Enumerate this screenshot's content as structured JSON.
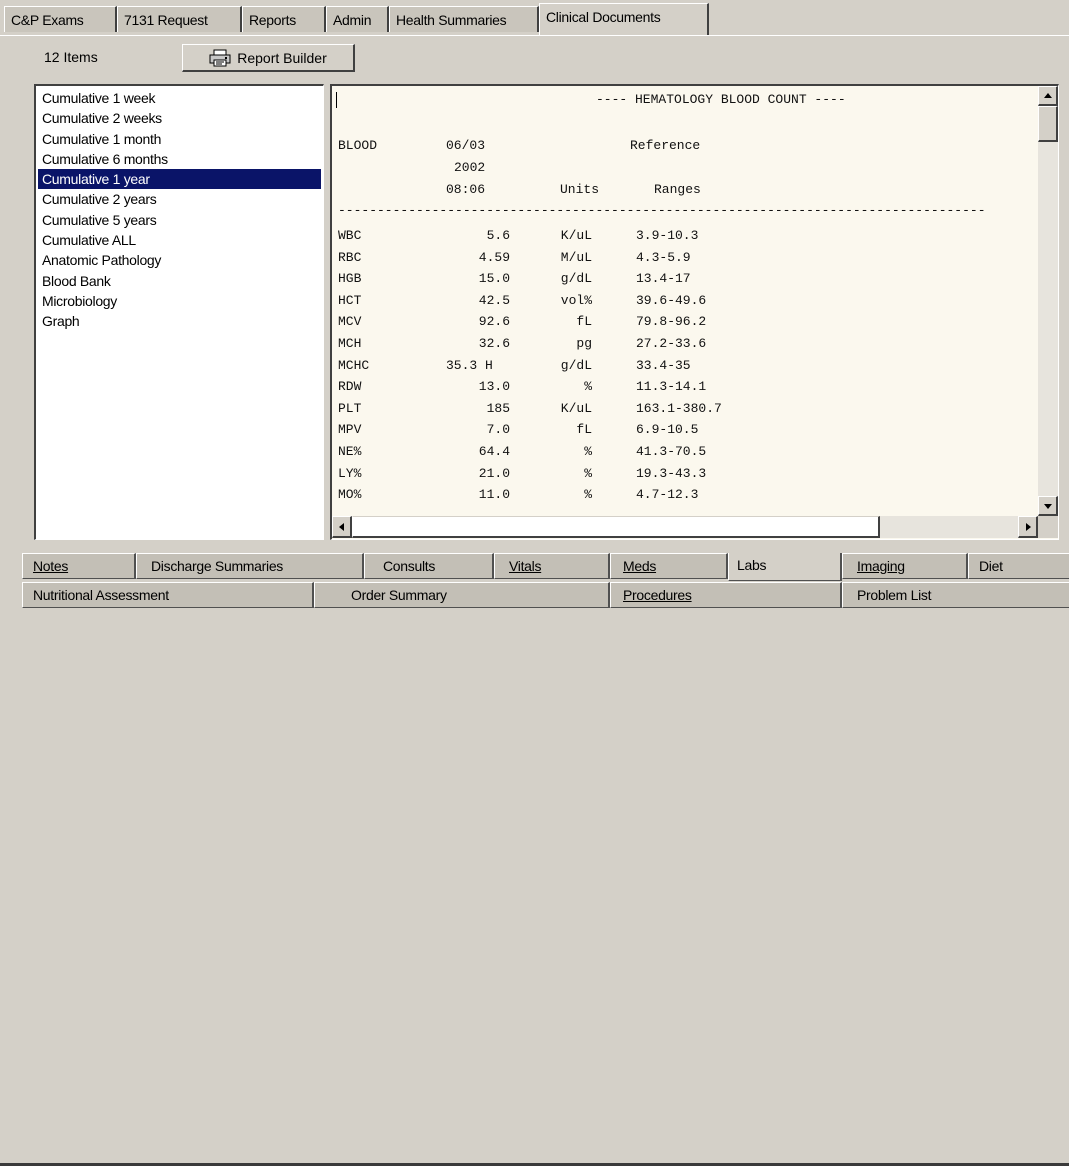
{
  "top_tabs": [
    {
      "label": "C&P Exams"
    },
    {
      "label": "7131 Request"
    },
    {
      "label": "Reports"
    },
    {
      "label": "Admin"
    },
    {
      "label": "Health Summaries"
    },
    {
      "label": "Clinical Documents",
      "active": true
    }
  ],
  "panel": {
    "items_count": "12 Items",
    "report_builder_label": "Report Builder"
  },
  "report_list": [
    "Cumulative 1 week",
    "Cumulative 2 weeks",
    "Cumulative 1 month",
    "Cumulative 6 months",
    "Cumulative 1 year",
    "Cumulative 2 years",
    "Cumulative 5 years",
    "Cumulative ALL",
    "Anatomic Pathology",
    "Blood Bank",
    "Microbiology",
    "Graph"
  ],
  "selected_report": "Cumulative 1 year",
  "report": {
    "title": "---- HEMATOLOGY BLOOD COUNT ----",
    "header": {
      "col1": "BLOOD",
      "date": "06/03",
      "year": "2002",
      "time": "08:06",
      "units": "Units",
      "reference": "Reference",
      "ranges": "Ranges"
    },
    "divider": "-----------------------------------------------------------------------------------",
    "rows": [
      {
        "test": "WBC",
        "value": "5.6",
        "units": "K/uL",
        "range": "3.9-10.3"
      },
      {
        "test": "RBC",
        "value": "4.59",
        "units": "M/uL",
        "range": "4.3-5.9"
      },
      {
        "test": "HGB",
        "value": "15.0",
        "units": "g/dL",
        "range": "13.4-17"
      },
      {
        "test": "HCT",
        "value": "42.5",
        "units": "vol%",
        "range": "39.6-49.6"
      },
      {
        "test": "MCV",
        "value": "92.6",
        "units": "fL",
        "range": "79.8-96.2"
      },
      {
        "test": "MCH",
        "value": "32.6",
        "units": "pg",
        "range": "27.2-33.6"
      },
      {
        "test": "MCHC",
        "value": "35.3 H",
        "units": "g/dL",
        "range": "33.4-35"
      },
      {
        "test": "RDW",
        "value": "13.0",
        "units": "%",
        "range": "11.3-14.1"
      },
      {
        "test": "PLT",
        "value": "185",
        "units": "K/uL",
        "range": "163.1-380.7"
      },
      {
        "test": "MPV",
        "value": "7.0",
        "units": "fL",
        "range": "6.9-10.5"
      },
      {
        "test": "NE%",
        "value": "64.4",
        "units": "%",
        "range": "41.3-70.5"
      },
      {
        "test": "LY%",
        "value": "21.0",
        "units": "%",
        "range": "19.3-43.3"
      },
      {
        "test": "MO%",
        "value": "11.0",
        "units": "%",
        "range": "4.7-12.3"
      }
    ]
  },
  "bottom_tabs_row1": [
    {
      "label": "Notes"
    },
    {
      "label": "Discharge Summaries"
    },
    {
      "label": "Consults"
    },
    {
      "label": "Vitals"
    },
    {
      "label": "Meds"
    },
    {
      "label": "Labs",
      "active": true
    },
    {
      "label": "Imaging"
    },
    {
      "label": "Diet"
    }
  ],
  "bottom_tabs_row2": [
    {
      "label": "Nutritional Assessment"
    },
    {
      "label": "Order Summary"
    },
    {
      "label": "Procedures"
    },
    {
      "label": "Problem List"
    }
  ],
  "colors": {
    "selection": "#0a1468",
    "face": "#d4d0c8",
    "report_bg": "#fbf8ee"
  }
}
